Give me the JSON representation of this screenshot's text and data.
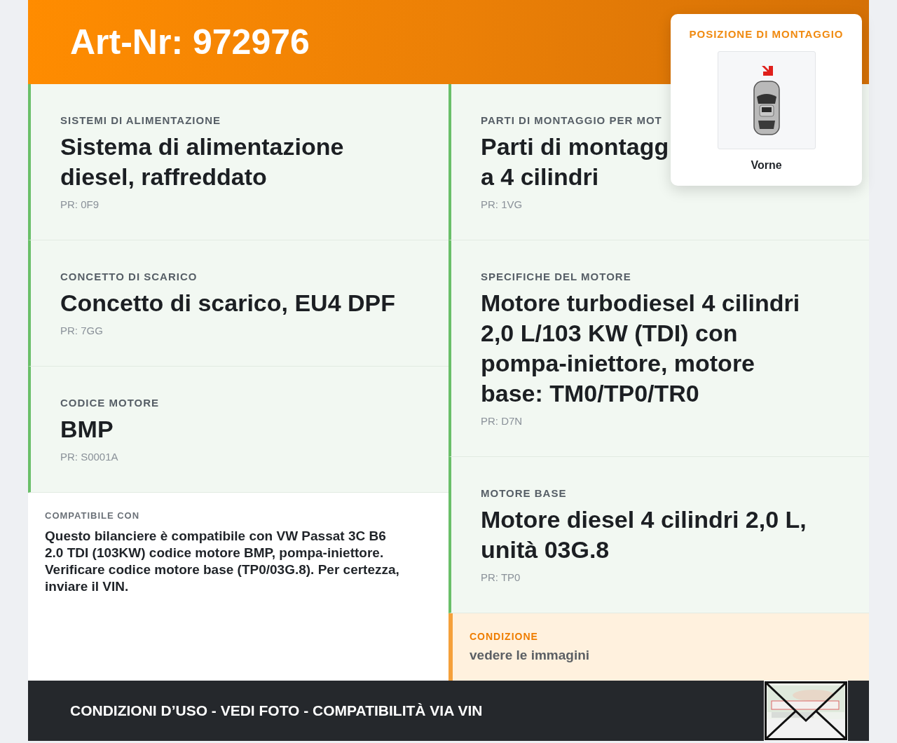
{
  "header": {
    "title": "Art-Nr: 972976"
  },
  "mounting_position": {
    "title": "POSIZIONE DI MONTAGGIO",
    "caption": "Vorne"
  },
  "left_cards": [
    {
      "label": "SISTEMI DI ALIMENTAZIONE",
      "title": "Sistema di alimentazione\ndiesel, raffreddato",
      "pr": "PR: 0F9"
    },
    {
      "label": "CONCETTO DI SCARICO",
      "title": "Concetto di scarico, EU4 DPF",
      "pr": "PR: 7GG"
    },
    {
      "label": "CODICE MOTORE",
      "title": "BMP",
      "pr": "PR: S0001A"
    }
  ],
  "compatibility": {
    "label": "COMPATIBILE CON",
    "text": "Questo bilanciere è compatibile con VW Passat 3C B6 2.0 TDI (103KW) codice motore BMP, pompa-iniettore. Verificare codice motore base (TP0/03G.8). Per certezza, inviare il VIN."
  },
  "right_cards": [
    {
      "label": "PARTI DI MONTAGGIO PER MOT",
      "title": "Parti di montagg\na 4 cilindri",
      "pr": "PR: 1VG"
    },
    {
      "label": "SPECIFICHE DEL MOTORE",
      "title": "Motore turbodiesel 4 cilindri\n2,0 L/103 KW (TDI) con\npompa-iniettore, motore\nbase: TM0/TP0/TR0",
      "pr": "PR: D7N"
    },
    {
      "label": "MOTORE BASE",
      "title": "Motore diesel 4 cilindri 2,0 L,\nunità 03G.8",
      "pr": "PR: TP0"
    }
  ],
  "condition": {
    "label": "CONDIZIONE",
    "value": "vedere le immagini"
  },
  "footer": {
    "text": "CONDIZIONI D’USO - VEDI FOTO - COMPATIBILITÀ VIA VIN"
  }
}
